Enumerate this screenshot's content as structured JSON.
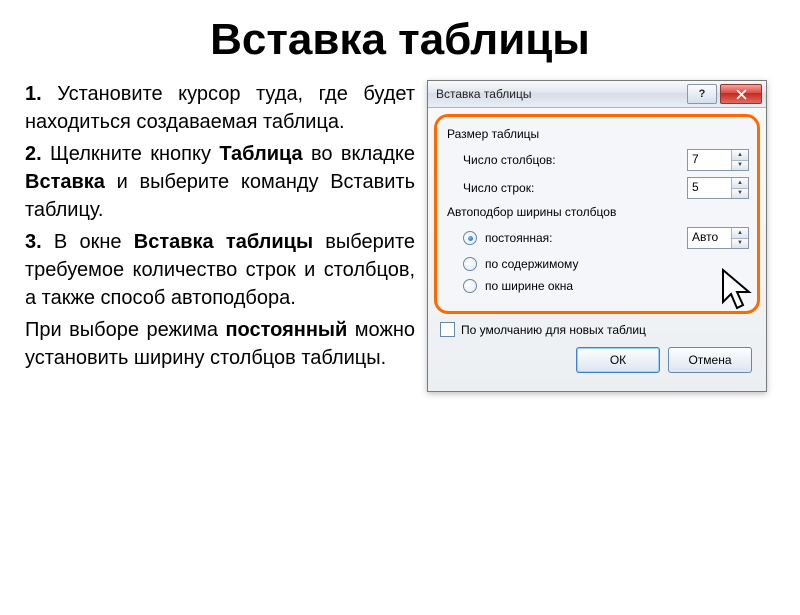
{
  "slide": {
    "title": "Вставка таблицы",
    "step1_num": "1.",
    "step1_text": " Установите курсор туда, где будет находиться создаваемая таблица.",
    "step2_num": "2.",
    "step2_a": " Щелкните кнопку ",
    "step2_b": "Таблица",
    "step2_c": " во вкладке ",
    "step2_d": "Вставка",
    "step2_e": " и выберите команду Вставить таблицу.",
    "step3_num": "3.",
    "step3_a": " В окне ",
    "step3_b": "Вставка таблицы",
    "step3_c": " выберите требуемое количество строк и столбцов, а также способ автоподбора.",
    "step4_a": "При выборе режима ",
    "step4_b": "постоянный",
    "step4_c": " можно установить ширину столбцов таблицы."
  },
  "dialog": {
    "title": "Вставка таблицы",
    "help": "?",
    "section_size": "Размер таблицы",
    "cols_label": "Число столбцов:",
    "cols_value": "7",
    "rows_label": "Число строк:",
    "rows_value": "5",
    "section_autofit": "Автоподбор ширины столбцов",
    "opt_fixed_a": "посто",
    "opt_fixed_b": "я",
    "opt_fixed_c": "нная:",
    "opt_fixed_val": "Авто",
    "opt_content": "по содержимому",
    "opt_window_a": "по ширине ",
    "opt_window_b": "о",
    "opt_window_c": "кна",
    "default_a": "По умолчанию для новых ",
    "default_b": "т",
    "default_c": "аблиц",
    "ok": "ОК",
    "cancel": "Отмена"
  }
}
